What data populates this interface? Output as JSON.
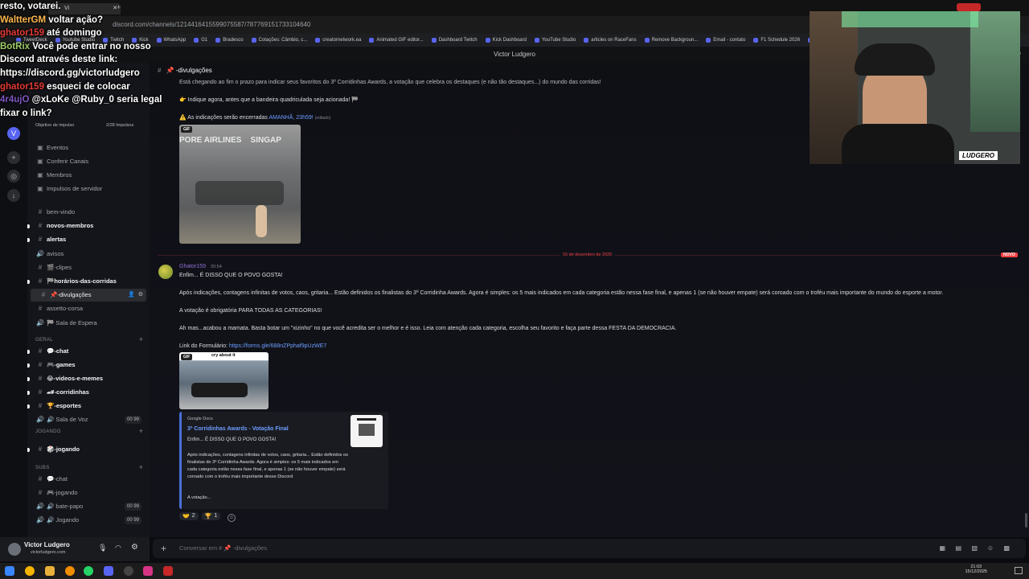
{
  "browser": {
    "url": "discord.com/channels/1214416415599075587/787769151733104640",
    "window_title": "Victor Ludgero",
    "bookmarks": [
      "TweetDeck",
      "Youtube Studio",
      "Twitch",
      "Kick",
      "WhatsApp",
      "G1",
      "Bradesco",
      "Cotações: Câmbio, c...",
      "creatornetwork.ea",
      "Animated GIF editor...",
      "Dashboard Twitch",
      "Kick Dashboard",
      "YouTube Studio",
      "articles on RaceFans",
      "Remove Backgroun...",
      "Email - contato",
      "F1 Schedule 2026",
      "NFS"
    ]
  },
  "overlay_chat": [
    {
      "user": "",
      "text": "resto, votarei.",
      "user_color": "#ffffff"
    },
    {
      "user": "WaltterGM",
      "text": "voltar ação?",
      "user_color": "#ffb74d"
    },
    {
      "user": "ghator159",
      "text": "até domingo",
      "user_color": "#e53935"
    },
    {
      "user": "BotRix",
      "text": "Você pode entrar no nosso Discord através deste link: https://discord.gg/victorludgero",
      "user_color": "#9ccc65"
    },
    {
      "user": "ghator159",
      "text": "esqueci de colocar",
      "user_color": "#e53935"
    },
    {
      "user": "4r4ujO",
      "text": "@xLoKe @Ruby_0 seria legal fixar o link?",
      "user_color": "#7e57c2"
    }
  ],
  "sidebar": {
    "boost": {
      "label": "Objetivo de impulso",
      "value": "2/28 Impulsos"
    },
    "menu": [
      {
        "label": "Eventos",
        "icon": "calendar-icon"
      },
      {
        "label": "Conferir Canais",
        "icon": "list-icon"
      },
      {
        "label": "Membros",
        "icon": "members-icon"
      },
      {
        "label": "Impulsos de servidor",
        "icon": "boost-icon"
      }
    ],
    "channels": [
      {
        "label": "bem-vindo",
        "icon": "#",
        "bold": false
      },
      {
        "label": "novos-membros",
        "icon": "#",
        "bold": true
      },
      {
        "label": "alertas",
        "icon": "#",
        "bold": true
      },
      {
        "label": "avisos",
        "icon": "🔊",
        "bold": false
      },
      {
        "label": "🎬-clipes",
        "icon": "#",
        "bold": false
      },
      {
        "label": "🏁horários-das-corridas",
        "icon": "#",
        "bold": true
      },
      {
        "label": "📌-divulgações",
        "icon": "#",
        "bold": false,
        "active": true
      },
      {
        "label": "assetto-corsa",
        "icon": "#",
        "bold": false
      },
      {
        "label": "🏁 Sala de Espera",
        "icon": "🔊",
        "bold": false
      }
    ],
    "cat_geral": "GERAL",
    "geral_channels": [
      {
        "label": "💬-chat",
        "icon": "#",
        "bold": true
      },
      {
        "label": "🎮-games",
        "icon": "#",
        "bold": true
      },
      {
        "label": "😂-videos-e-memes",
        "icon": "#",
        "bold": true
      },
      {
        "label": "🏎-corridinhas",
        "icon": "#",
        "bold": true
      },
      {
        "label": "🏆-esportes",
        "icon": "#",
        "bold": true
      },
      {
        "label": "🔊 Sala de Voz",
        "icon": "🔊",
        "bold": false,
        "vc": "00 99"
      }
    ],
    "cat_jogando": "jogando",
    "jogando_channels": [
      {
        "label": "🎲-jogando",
        "icon": "#",
        "bold": true
      }
    ],
    "cat_subs": "SUBS",
    "subs_channels": [
      {
        "label": "💬-chat",
        "icon": "#",
        "bold": false
      },
      {
        "label": "🎮-jogando",
        "icon": "#",
        "bold": false
      },
      {
        "label": "🔊 bate-papo",
        "icon": "🔊",
        "bold": false,
        "vc": "00 99"
      },
      {
        "label": "🔊 Jogando",
        "icon": "🔊",
        "bold": false,
        "vc": "00 99"
      }
    ]
  },
  "user_panel": {
    "name": "Victor Ludgero",
    "handle": "victorludgero.com"
  },
  "channel": {
    "name": "📌 -divulgações"
  },
  "messages": {
    "m1_l1": "Está chegando ao fim o prazo para indicar seus favoritos do 3º Corridinhas Awards, a votação que celebra os destaques (e não tão destaques...) do mundo das corridas!",
    "m1_l2": "👉 Indique agora, antes que a bandeira quadriculada seja acionada! 🏁",
    "m1_l3": "⚠️ As indicações serão encerradas ",
    "m1_l3_highlight": "AMANHÃ, 23h59!",
    "m1_l3_edited": "(editado)",
    "gif1_label": "GIF",
    "gif1_caption": "PORE AIRLINES    SINGAP",
    "date_divider": "15 de dezembro de 2025",
    "new_badge": "NOVO",
    "m2_user": "Ghator159",
    "m2_time": "20:54",
    "m2_l1": "Enfim... É DISSO QUE O POVO GOSTA!",
    "m2_l2": "Após indicações, contagens infinitas de votos, caos, gritaria... Estão definidos os finalistas do 3º Corridinha Awards. Agora é simples: os 5 mais indicados em cada categoria estão nessa fase final, e apenas 1 (se não houver empate) será coroado com o troféu mais importante do mundo do esporte a motor.",
    "m2_l3": "A votação é obrigatória PARA TODAS AS CATEGORIAS!",
    "m2_l4": "Ah mas...acabou a mamata. Basta botar um \"xizinho\" no que você acredita ser o melhor e é isso. Leia com atenção cada categoria, escolha seu favorito e faça parte dessa FESTA DA DEMOCRACIA.",
    "m2_l5": "Link do Formulário: ",
    "m2_link": "https://forms.gle/688nZPphaf9pUzWE7",
    "gif2_label": "GIF",
    "gif2_caption": "cry about it",
    "embed_provider": "Google Docs",
    "embed_title": "3º Corridinhas Awards - Votação Final",
    "embed_desc1": "Enfim... É DISSO QUE O POVO GOSTA!",
    "embed_desc2": "Após indicações, contagens infinitas de votos, caos, gritaria... Estão definidos os finalistas do 3º Corridinha Awards. Agora é simples: os 5 mais indicados em cada categoria estão nessa fase final, e apenas 1 (se não houver empate) será coroado com o troféu mais importante desse Discord",
    "embed_desc3": "A votação...",
    "reactions": [
      {
        "emoji": "🤝",
        "count": "2"
      },
      {
        "emoji": "🏆",
        "count": "1"
      }
    ]
  },
  "composer": {
    "placeholder": "Conversar em # 📌 -divulgações"
  },
  "taskbar": {
    "time": "21:03",
    "date": "15/12/2025"
  },
  "webcam": {
    "badge": "LUDGERO"
  },
  "colors": {
    "accent": "#5865f2",
    "link": "#6d9eff",
    "username": "#8f6fd6",
    "new": "#f23f43"
  }
}
